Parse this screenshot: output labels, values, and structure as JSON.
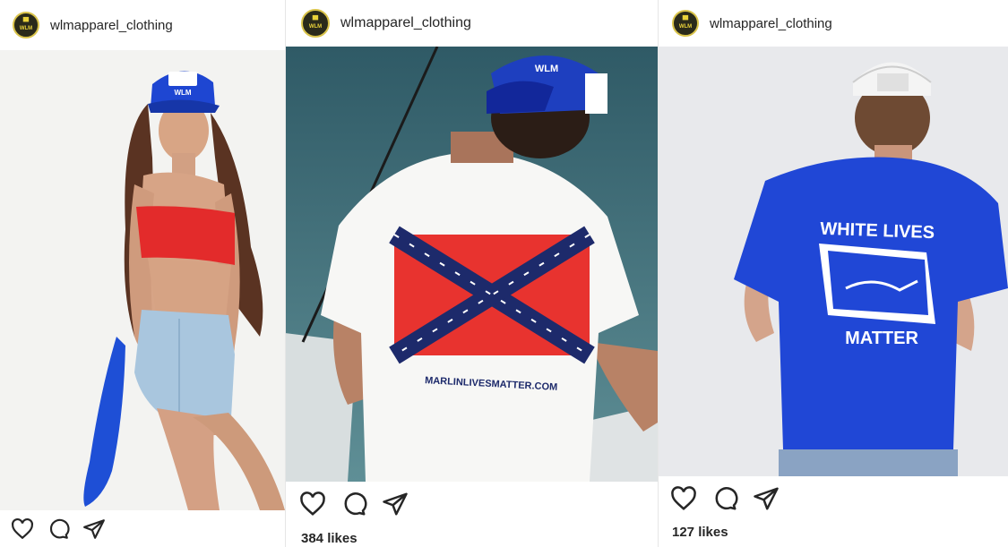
{
  "posts": [
    {
      "username": "wlmapparel_clothing",
      "avatar_text": "WLM",
      "likes": "",
      "hat_text": "WLM",
      "icons": [
        "heart-icon",
        "comment-icon",
        "share-icon"
      ]
    },
    {
      "username": "wlmapparel_clothing",
      "avatar_text": "WLM",
      "likes": "384 likes",
      "hat_text": "WLM",
      "shirt_text": "MARLINLIVESMATTER.COM",
      "icons": [
        "heart-icon",
        "comment-icon",
        "share-icon"
      ]
    },
    {
      "username": "wlmapparel_clothing",
      "avatar_text": "WLM",
      "likes": "127 likes",
      "shirt_text_top": "WHITE LIVES",
      "shirt_text_bottom": "MATTER",
      "icons": [
        "heart-icon",
        "comment-icon",
        "share-icon"
      ]
    }
  ],
  "colors": {
    "text": "#262626",
    "royal_blue": "#1f3fd0",
    "flag_red": "#e8332f",
    "flag_navy": "#1d2a6b",
    "water": "#3f6f7a"
  }
}
